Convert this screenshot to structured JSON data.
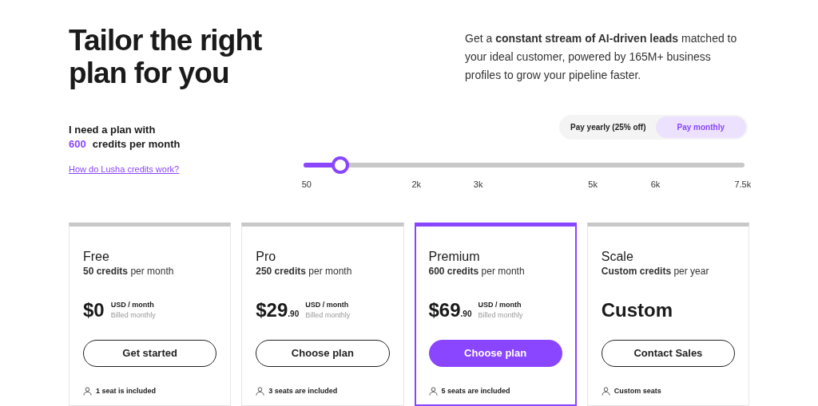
{
  "headline": "Tailor the right plan for you",
  "intro": "Get a **constant stream of AI-driven leads** matched to your ideal customer, powered by 165M+ business profiles to grow your pipeline faster.",
  "plan_prompt": {
    "line_1": "I need a plan with",
    "credits": "600",
    "unit": "credits per month"
  },
  "billing_toggle": [
    {
      "label": "Pay yearly (25% off)",
      "selected": false
    },
    {
      "label": "Pay monthly",
      "selected": true
    }
  ],
  "help_link": "How do Lusha credits work?",
  "credits_slider": {
    "level": 0.084,
    "ticks": [
      "50",
      "2k",
      "3k",
      "5k",
      "6k",
      "7.5k"
    ]
  },
  "plans": [
    {
      "name": "Free",
      "credits": "**50 credits** per month",
      "kind": "priced",
      "price": "$0",
      "price_unit": "USD / month",
      "billing": "Billed monthly",
      "button": "Get started",
      "selected": false,
      "seats": "1 seat is included"
    },
    {
      "name": "Pro",
      "credits": "**250 credits** per month",
      "kind": "priced",
      "price": "$29",
      "cents": ".90",
      "price_unit": "USD / month",
      "billing": "Billed monthly",
      "button": "Choose plan",
      "selected": false,
      "seats": "3 seats are included"
    },
    {
      "name": "Premium",
      "credits": "**600 credits** per month",
      "kind": "priced",
      "price": "$69",
      "cents": ".90",
      "price_unit": "USD / month",
      "billing": "Billed monthly",
      "button": "Choose plan",
      "selected": true,
      "seats": "5 seats are included"
    },
    {
      "name": "Scale",
      "credits": "**Custom credits** per year",
      "kind": "custom",
      "price": "Custom",
      "button": "Contact Sales",
      "selected": false,
      "seats": "Custom seats"
    }
  ]
}
